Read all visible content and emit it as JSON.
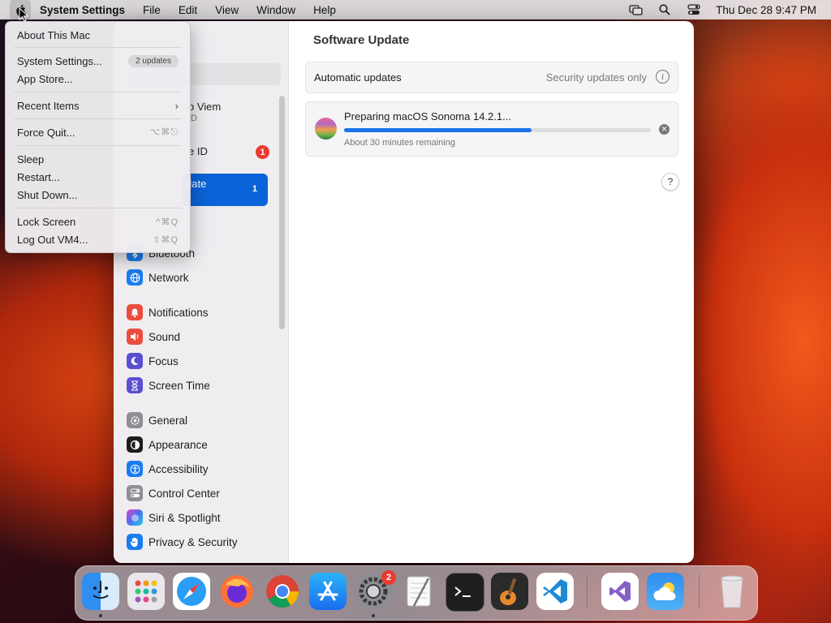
{
  "menubar": {
    "app_name": "System Settings",
    "menus": [
      "File",
      "Edit",
      "View",
      "Window",
      "Help"
    ],
    "clock": "Thu Dec 28  9:47 PM"
  },
  "apple_menu": {
    "about": "About This Mac",
    "system_settings": "System Settings...",
    "system_settings_badge": "2 updates",
    "app_store": "App Store...",
    "recent_items": "Recent Items",
    "force_quit": "Force Quit...",
    "force_quit_shortcut": "⌥⌘⎋",
    "sleep": "Sleep",
    "restart": "Restart...",
    "shut_down": "Shut Down...",
    "lock_screen": "Lock Screen",
    "lock_screen_shortcut": "^⌘Q",
    "log_out": "Log Out VM4...",
    "log_out_shortcut": "⇧⌘Q"
  },
  "sidebar": {
    "account_name_partial": "o Viem",
    "account_sub_partial": "ID",
    "apple_id_partial": "e ID",
    "apple_id_badge": "1",
    "selected_partial": "date",
    "selected_badge": "1",
    "items": [
      {
        "label": "Bluetooth",
        "icon": "bluetooth-icon",
        "color": "#1a7cf0"
      },
      {
        "label": "Network",
        "icon": "globe-icon",
        "color": "#1a7cf0"
      },
      {
        "label": "Notifications",
        "icon": "bell-icon",
        "color": "#eb4d3d"
      },
      {
        "label": "Sound",
        "icon": "speaker-icon",
        "color": "#eb4d3d"
      },
      {
        "label": "Focus",
        "icon": "moon-icon",
        "color": "#5b4fd1"
      },
      {
        "label": "Screen Time",
        "icon": "hourglass-icon",
        "color": "#5b4fd1"
      },
      {
        "label": "General",
        "icon": "gear-icon",
        "color": "#8e8e93"
      },
      {
        "label": "Appearance",
        "icon": "appearance-icon",
        "color": "#1c1c1e"
      },
      {
        "label": "Accessibility",
        "icon": "accessibility-icon",
        "color": "#1a7cf0"
      },
      {
        "label": "Control Center",
        "icon": "toggles-icon",
        "color": "#8e8e93"
      },
      {
        "label": "Siri & Spotlight",
        "icon": "siri-icon",
        "color": "#8b3fd6"
      },
      {
        "label": "Privacy & Security",
        "icon": "hand-icon",
        "color": "#1a7cf0"
      }
    ]
  },
  "main": {
    "title": "Software Update",
    "auto_updates_label": "Automatic updates",
    "auto_updates_value": "Security updates only",
    "update_title": "Preparing macOS Sonoma 14.2.1...",
    "update_status": "About 30 minutes remaining",
    "progress": 0.61
  },
  "dock": {
    "apps": [
      "Finder",
      "Launchpad",
      "Safari",
      "Firefox",
      "Chrome",
      "App Store",
      "System Settings",
      "TextEdit",
      "Terminal",
      "GarageBand",
      "VS Code",
      "Visual Studio",
      "Weather",
      "Trash"
    ],
    "settings_badge": "2"
  }
}
